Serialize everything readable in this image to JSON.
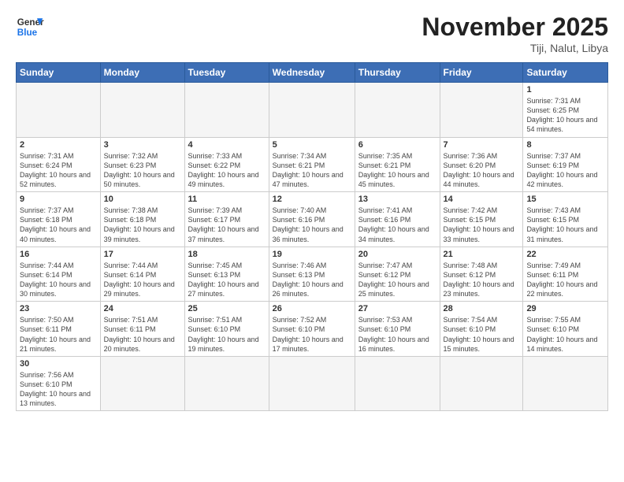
{
  "header": {
    "logo_general": "General",
    "logo_blue": "Blue",
    "title": "November 2025",
    "subtitle": "Tiji, Nalut, Libya"
  },
  "weekdays": [
    "Sunday",
    "Monday",
    "Tuesday",
    "Wednesday",
    "Thursday",
    "Friday",
    "Saturday"
  ],
  "weeks": [
    [
      {
        "day": "",
        "info": ""
      },
      {
        "day": "",
        "info": ""
      },
      {
        "day": "",
        "info": ""
      },
      {
        "day": "",
        "info": ""
      },
      {
        "day": "",
        "info": ""
      },
      {
        "day": "",
        "info": ""
      },
      {
        "day": "1",
        "info": "Sunrise: 7:31 AM\nSunset: 6:25 PM\nDaylight: 10 hours and 54 minutes."
      }
    ],
    [
      {
        "day": "2",
        "info": "Sunrise: 7:31 AM\nSunset: 6:24 PM\nDaylight: 10 hours and 52 minutes."
      },
      {
        "day": "3",
        "info": "Sunrise: 7:32 AM\nSunset: 6:23 PM\nDaylight: 10 hours and 50 minutes."
      },
      {
        "day": "4",
        "info": "Sunrise: 7:33 AM\nSunset: 6:22 PM\nDaylight: 10 hours and 49 minutes."
      },
      {
        "day": "5",
        "info": "Sunrise: 7:34 AM\nSunset: 6:21 PM\nDaylight: 10 hours and 47 minutes."
      },
      {
        "day": "6",
        "info": "Sunrise: 7:35 AM\nSunset: 6:21 PM\nDaylight: 10 hours and 45 minutes."
      },
      {
        "day": "7",
        "info": "Sunrise: 7:36 AM\nSunset: 6:20 PM\nDaylight: 10 hours and 44 minutes."
      },
      {
        "day": "8",
        "info": "Sunrise: 7:37 AM\nSunset: 6:19 PM\nDaylight: 10 hours and 42 minutes."
      }
    ],
    [
      {
        "day": "9",
        "info": "Sunrise: 7:37 AM\nSunset: 6:18 PM\nDaylight: 10 hours and 40 minutes."
      },
      {
        "day": "10",
        "info": "Sunrise: 7:38 AM\nSunset: 6:18 PM\nDaylight: 10 hours and 39 minutes."
      },
      {
        "day": "11",
        "info": "Sunrise: 7:39 AM\nSunset: 6:17 PM\nDaylight: 10 hours and 37 minutes."
      },
      {
        "day": "12",
        "info": "Sunrise: 7:40 AM\nSunset: 6:16 PM\nDaylight: 10 hours and 36 minutes."
      },
      {
        "day": "13",
        "info": "Sunrise: 7:41 AM\nSunset: 6:16 PM\nDaylight: 10 hours and 34 minutes."
      },
      {
        "day": "14",
        "info": "Sunrise: 7:42 AM\nSunset: 6:15 PM\nDaylight: 10 hours and 33 minutes."
      },
      {
        "day": "15",
        "info": "Sunrise: 7:43 AM\nSunset: 6:15 PM\nDaylight: 10 hours and 31 minutes."
      }
    ],
    [
      {
        "day": "16",
        "info": "Sunrise: 7:44 AM\nSunset: 6:14 PM\nDaylight: 10 hours and 30 minutes."
      },
      {
        "day": "17",
        "info": "Sunrise: 7:44 AM\nSunset: 6:14 PM\nDaylight: 10 hours and 29 minutes."
      },
      {
        "day": "18",
        "info": "Sunrise: 7:45 AM\nSunset: 6:13 PM\nDaylight: 10 hours and 27 minutes."
      },
      {
        "day": "19",
        "info": "Sunrise: 7:46 AM\nSunset: 6:13 PM\nDaylight: 10 hours and 26 minutes."
      },
      {
        "day": "20",
        "info": "Sunrise: 7:47 AM\nSunset: 6:12 PM\nDaylight: 10 hours and 25 minutes."
      },
      {
        "day": "21",
        "info": "Sunrise: 7:48 AM\nSunset: 6:12 PM\nDaylight: 10 hours and 23 minutes."
      },
      {
        "day": "22",
        "info": "Sunrise: 7:49 AM\nSunset: 6:11 PM\nDaylight: 10 hours and 22 minutes."
      }
    ],
    [
      {
        "day": "23",
        "info": "Sunrise: 7:50 AM\nSunset: 6:11 PM\nDaylight: 10 hours and 21 minutes."
      },
      {
        "day": "24",
        "info": "Sunrise: 7:51 AM\nSunset: 6:11 PM\nDaylight: 10 hours and 20 minutes."
      },
      {
        "day": "25",
        "info": "Sunrise: 7:51 AM\nSunset: 6:10 PM\nDaylight: 10 hours and 19 minutes."
      },
      {
        "day": "26",
        "info": "Sunrise: 7:52 AM\nSunset: 6:10 PM\nDaylight: 10 hours and 17 minutes."
      },
      {
        "day": "27",
        "info": "Sunrise: 7:53 AM\nSunset: 6:10 PM\nDaylight: 10 hours and 16 minutes."
      },
      {
        "day": "28",
        "info": "Sunrise: 7:54 AM\nSunset: 6:10 PM\nDaylight: 10 hours and 15 minutes."
      },
      {
        "day": "29",
        "info": "Sunrise: 7:55 AM\nSunset: 6:10 PM\nDaylight: 10 hours and 14 minutes."
      }
    ],
    [
      {
        "day": "30",
        "info": "Sunrise: 7:56 AM\nSunset: 6:10 PM\nDaylight: 10 hours and 13 minutes."
      },
      {
        "day": "",
        "info": ""
      },
      {
        "day": "",
        "info": ""
      },
      {
        "day": "",
        "info": ""
      },
      {
        "day": "",
        "info": ""
      },
      {
        "day": "",
        "info": ""
      },
      {
        "day": "",
        "info": ""
      }
    ]
  ]
}
